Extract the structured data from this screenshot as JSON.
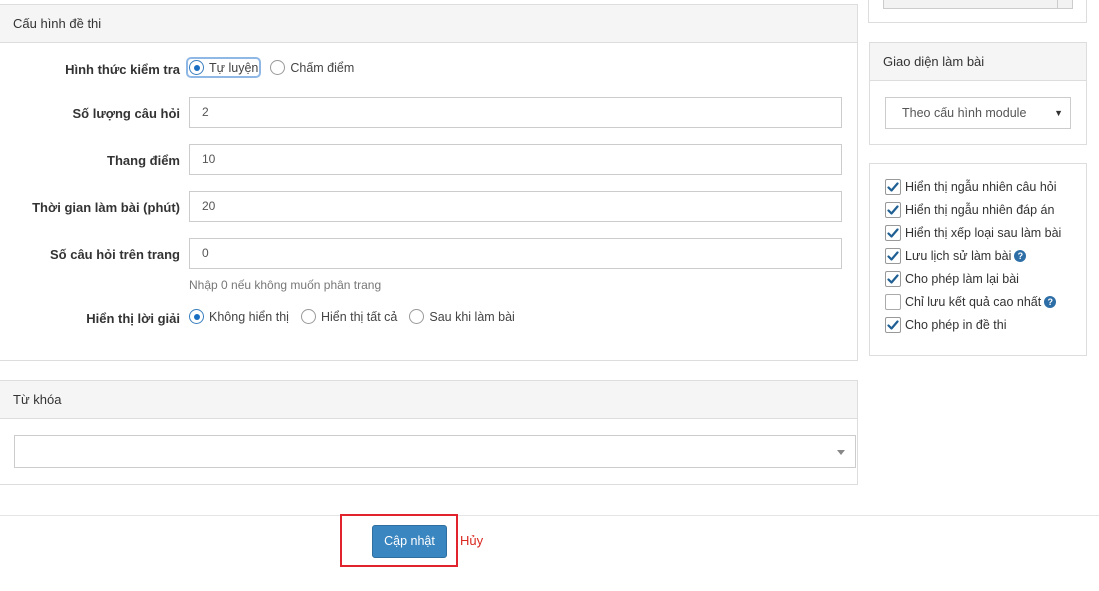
{
  "config": {
    "heading": "Cấu hình đề thi",
    "test_type": {
      "label": "Hình thức kiểm tra",
      "options": [
        "Tự luyện",
        "Chấm điểm"
      ],
      "selected": "Tự luyện"
    },
    "question_count": {
      "label": "Số lượng câu hỏi",
      "value": "2"
    },
    "score_scale": {
      "label": "Thang điểm",
      "value": "10"
    },
    "duration": {
      "label": "Thời gian làm bài (phút)",
      "value": "20"
    },
    "per_page": {
      "label": "Số câu hỏi trên trang",
      "value": "0",
      "help": "Nhập 0 nếu không muốn phân trang"
    },
    "show_solution": {
      "label": "Hiển thị lời giải",
      "options": [
        "Không hiển thị",
        "Hiển thị tất cả",
        "Sau khi làm bài"
      ],
      "selected": "Không hiển thị"
    }
  },
  "keywords": {
    "heading": "Từ khóa",
    "value": ""
  },
  "interface": {
    "heading": "Giao diện làm bài",
    "selected": "Theo cấu hình module"
  },
  "options": [
    {
      "label": "Hiển thị ngẫu nhiên câu hỏi",
      "checked": true,
      "help": false
    },
    {
      "label": "Hiển thị ngẫu nhiên đáp án",
      "checked": true,
      "help": false
    },
    {
      "label": "Hiển thị xếp loại sau làm bài",
      "checked": true,
      "help": false
    },
    {
      "label": "Lưu lịch sử làm bài",
      "checked": true,
      "help": true
    },
    {
      "label": "Cho phép làm lại bài",
      "checked": true,
      "help": false
    },
    {
      "label": "Chỉ lưu kết quả cao nhất",
      "checked": false,
      "help": true
    },
    {
      "label": "Cho phép in đề thi",
      "checked": true,
      "help": false
    }
  ],
  "actions": {
    "update_label": "Cập nhật",
    "cancel_label": "Hủy"
  },
  "colors": {
    "primary_button": "#3a86c0",
    "cancel_link": "#d9281f",
    "highlight_border": "#e0232d",
    "checkbox_tick": "#1f5f93"
  },
  "icons": {
    "checked": "check-icon",
    "help": "question-circle-icon",
    "caret": "caret-down-icon"
  }
}
